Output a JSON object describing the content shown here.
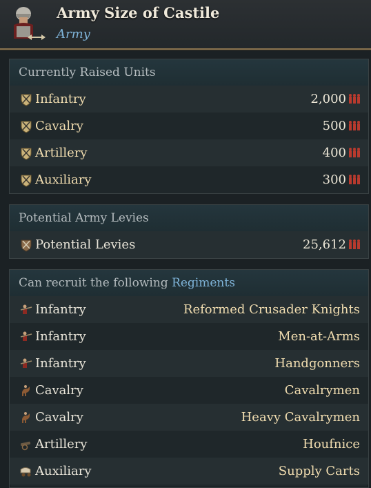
{
  "header": {
    "title": "Army Size of Castile",
    "subtitle": "Army",
    "icon": "soldier-helmet-icon"
  },
  "raised": {
    "heading": "Currently Raised Units",
    "rows": [
      {
        "label": "Infantry",
        "value": "2,000"
      },
      {
        "label": "Cavalry",
        "value": "500"
      },
      {
        "label": "Artillery",
        "value": "400"
      },
      {
        "label": "Auxiliary",
        "value": "300"
      }
    ]
  },
  "levies": {
    "heading": "Potential Army Levies",
    "rows": [
      {
        "label": "Potential Levies",
        "value": "25,612"
      }
    ]
  },
  "regiments": {
    "heading_prefix": "Can recruit the following",
    "heading_link": "Regiments",
    "rows": [
      {
        "type": "Infantry",
        "name": "Reformed Crusader Knights",
        "icon": "infantry-icon"
      },
      {
        "type": "Infantry",
        "name": "Men-at-Arms",
        "icon": "infantry-icon"
      },
      {
        "type": "Infantry",
        "name": "Handgonners",
        "icon": "infantry-icon"
      },
      {
        "type": "Cavalry",
        "name": "Cavalrymen",
        "icon": "cavalry-icon"
      },
      {
        "type": "Cavalry",
        "name": "Heavy Cavalrymen",
        "icon": "cavalry-icon"
      },
      {
        "type": "Artillery",
        "name": "Houfnice",
        "icon": "artillery-icon"
      },
      {
        "type": "Auxiliary",
        "name": "Supply Carts",
        "icon": "supply-cart-icon"
      }
    ]
  },
  "colors": {
    "gold_text": "#f1ddb0",
    "accent_blue": "#7fb4d9",
    "border_gold": "#8a7450"
  }
}
